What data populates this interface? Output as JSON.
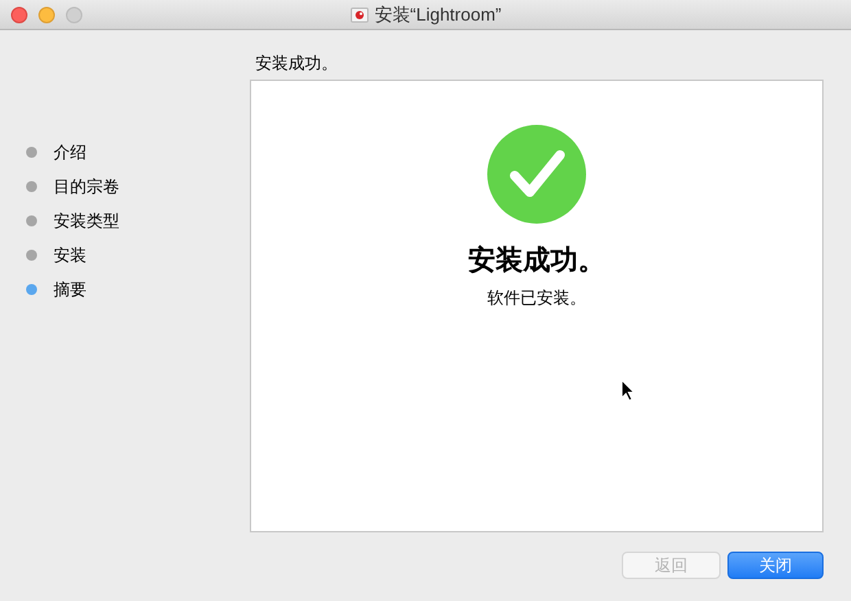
{
  "window": {
    "title": "安装“Lightroom”"
  },
  "steps": [
    {
      "label": "介绍",
      "selected": false
    },
    {
      "label": "目的宗卷",
      "selected": false
    },
    {
      "label": "安装类型",
      "selected": false
    },
    {
      "label": "安装",
      "selected": false
    },
    {
      "label": "摘要",
      "selected": true
    }
  ],
  "heading": "安装成功。",
  "panel": {
    "title": "安装成功。",
    "message": "软件已安装。"
  },
  "buttons": [
    {
      "label": "返回",
      "disabled": true
    },
    {
      "label": "关闭",
      "disabled": false
    }
  ]
}
